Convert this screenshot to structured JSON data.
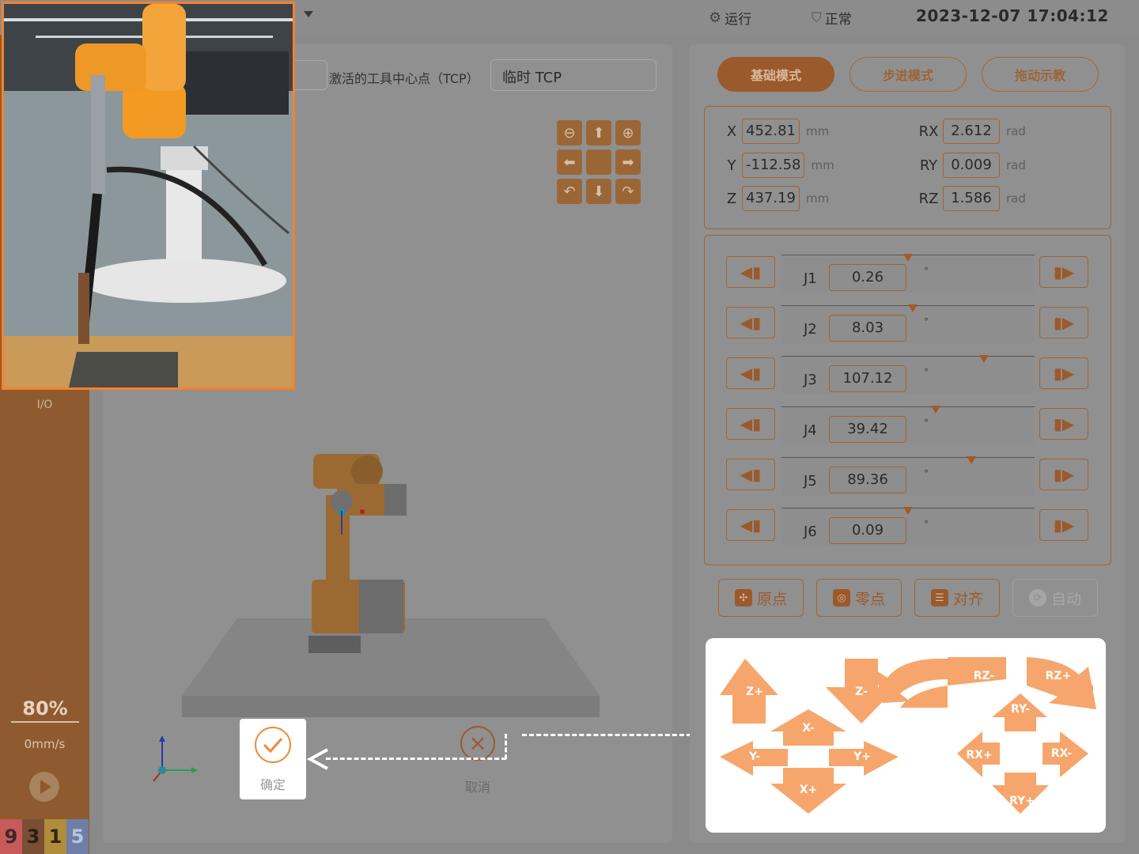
{
  "topbar": {
    "run_label": "运行",
    "status_label": "正常",
    "datetime": "2023-12-07 17:04:12"
  },
  "sidebar": {
    "io_label": "I/O",
    "speed_percent": "80%",
    "velocity": "0mm/s",
    "code_digits": [
      {
        "text": "9",
        "bg": "#c85a5a",
        "color": "#3b2a2a"
      },
      {
        "text": "3",
        "bg": "#7a4f34",
        "color": "#2c1d14"
      },
      {
        "text": "1",
        "bg": "#b08d3a",
        "color": "#2e2510"
      },
      {
        "text": "5",
        "bg": "#6f7ea6",
        "color": "#b9c6e0"
      }
    ]
  },
  "center": {
    "tcp_label": "激活的工具中心点（TCP）",
    "tcp_value": "临时 TCP",
    "view_buttons": [
      "zoom-out",
      "up",
      "zoom-in",
      "left",
      "center",
      "right",
      "rotate-left",
      "down",
      "rotate-right"
    ],
    "confirm_label": "确定",
    "cancel_label": "取消"
  },
  "right": {
    "modes": [
      {
        "label": "基础模式",
        "active": true
      },
      {
        "label": "步进模式",
        "active": false
      },
      {
        "label": "拖动示教",
        "active": false
      }
    ],
    "position": [
      {
        "axis": "X",
        "value": "452.81",
        "unit": "mm"
      },
      {
        "axis": "Y",
        "value": "-112.58",
        "unit": "mm"
      },
      {
        "axis": "Z",
        "value": "437.19",
        "unit": "mm"
      }
    ],
    "rotation": [
      {
        "axis": "RX",
        "value": "2.612",
        "unit": "rad"
      },
      {
        "axis": "RY",
        "value": "0.009",
        "unit": "rad"
      },
      {
        "axis": "RZ",
        "value": "1.586",
        "unit": "rad"
      }
    ],
    "joints": [
      {
        "name": "J1",
        "value": "0.26",
        "unit": "°",
        "marker_fraction": 0.5
      },
      {
        "name": "J2",
        "value": "8.03",
        "unit": "°",
        "marker_fraction": 0.52
      },
      {
        "name": "J3",
        "value": "107.12",
        "unit": "°",
        "marker_fraction": 0.8
      },
      {
        "name": "J4",
        "value": "39.42",
        "unit": "°",
        "marker_fraction": 0.61
      },
      {
        "name": "J5",
        "value": "89.36",
        "unit": "°",
        "marker_fraction": 0.75
      },
      {
        "name": "J6",
        "value": "0.09",
        "unit": "°",
        "marker_fraction": 0.5
      }
    ],
    "actions": [
      {
        "label": "原点",
        "icon": "home-icon",
        "disabled": false
      },
      {
        "label": "零点",
        "icon": "zero-icon",
        "disabled": false
      },
      {
        "label": "对齐",
        "icon": "align-icon",
        "disabled": false
      },
      {
        "label": "自动",
        "icon": "auto-icon",
        "disabled": true
      }
    ]
  },
  "jog": {
    "linear": [
      "Z+",
      "Z-",
      "X-",
      "Y-",
      "Y+",
      "X+"
    ],
    "rotary": [
      "RZ-",
      "RZ+",
      "RY-",
      "RX+",
      "RX-",
      "RY+"
    ]
  },
  "colors": {
    "accent": "#f5822a",
    "accent_dim": "#9b5a2c",
    "overlay_gray": "#909090"
  }
}
